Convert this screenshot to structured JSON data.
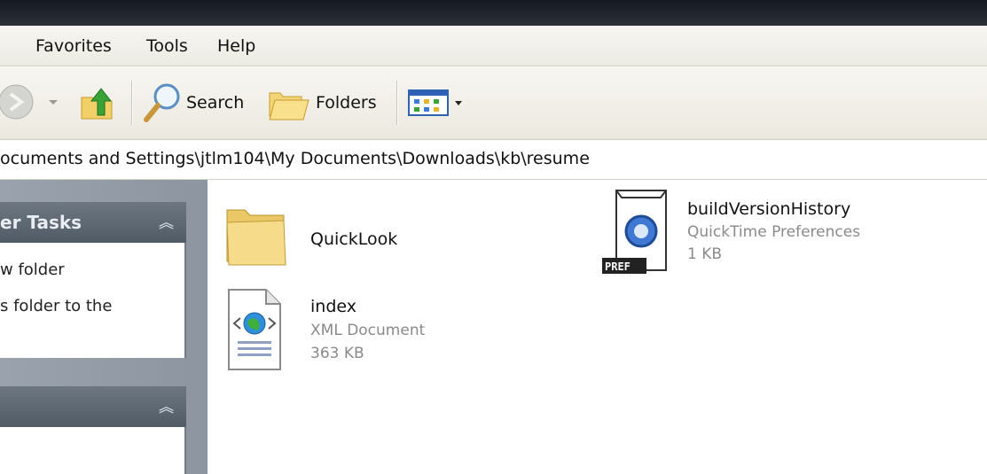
{
  "menu": {
    "favorites": "Favorites",
    "tools": "Tools",
    "help": "Help"
  },
  "toolbar": {
    "search_label": "Search",
    "folders_label": "Folders",
    "icons": [
      "forward-icon",
      "up-folder-icon",
      "search-icon",
      "folders-icon",
      "views-icon"
    ]
  },
  "address": {
    "path": "ocuments and Settings\\jtlm104\\My Documents\\Downloads\\kb\\resume"
  },
  "taskpane": {
    "panel1": {
      "title": "er Tasks",
      "links": [
        "w folder",
        "s folder to the"
      ]
    },
    "panel2": {
      "title": ""
    }
  },
  "files": [
    {
      "name": "QuickLook",
      "type": "",
      "size": "",
      "icon": "folder-icon"
    },
    {
      "name": "buildVersionHistory",
      "type": "QuickTime Preferences",
      "size": "1 KB",
      "icon": "quicktime-pref-icon"
    },
    {
      "name": "index",
      "type": "XML Document",
      "size": "363 KB",
      "icon": "xml-document-icon"
    }
  ],
  "colors": {
    "titlebar": "#1c212a",
    "taskpane_header": "#5c6671",
    "taskpane_bg": "#939ca6"
  }
}
